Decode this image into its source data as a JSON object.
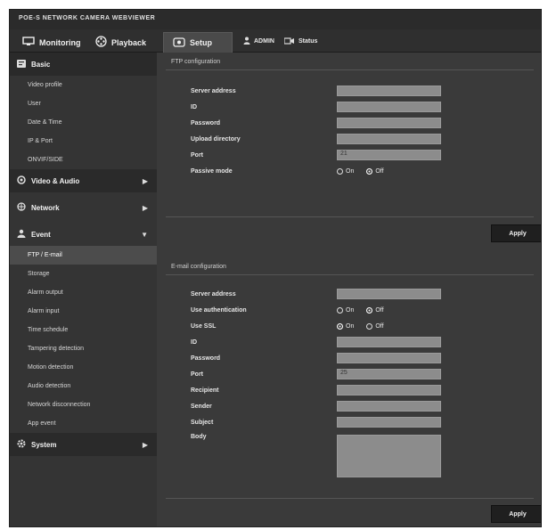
{
  "window": {
    "title": "POE-S NETWORK CAMERA WEBVIEWER"
  },
  "topnav": {
    "tabs": [
      {
        "label": "Monitoring"
      },
      {
        "label": "Playback"
      },
      {
        "label": "Setup"
      }
    ],
    "user": "ADMIN",
    "status": "Status"
  },
  "sidebar": {
    "basic": {
      "label": "Basic",
      "items": [
        "Video profile",
        "User",
        "Date & Time",
        "IP & Port",
        "ONVIF/SIDE"
      ]
    },
    "video_audio": "Video & Audio",
    "network": "Network",
    "event": {
      "label": "Event",
      "items": [
        "FTP / E-mail",
        "Storage",
        "Alarm output",
        "Alarm input",
        "Time schedule",
        "Tampering detection",
        "Motion detection",
        "Audio detection",
        "Network disconnection",
        "App event"
      ]
    },
    "system": "System"
  },
  "ftp": {
    "title": "FTP configuration",
    "fields": {
      "server": "Server address",
      "id": "ID",
      "password": "Password",
      "upload_dir": "Upload directory",
      "port": "Port",
      "passive": "Passive mode"
    },
    "values": {
      "port": "21"
    },
    "passive_options": [
      "On",
      "Off"
    ],
    "apply": "Apply"
  },
  "email": {
    "title": "E-mail configuration",
    "fields": {
      "server": "Server address",
      "auth": "Use authentication",
      "ssl": "Use SSL",
      "id": "ID",
      "password": "Password",
      "port": "Port",
      "recipient": "Recipient",
      "sender": "Sender",
      "subject": "Subject",
      "body": "Body"
    },
    "values": {
      "port": "25"
    },
    "auth_options": [
      "On",
      "Off"
    ],
    "ssl_options": [
      "On",
      "Off"
    ],
    "apply": "Apply"
  }
}
